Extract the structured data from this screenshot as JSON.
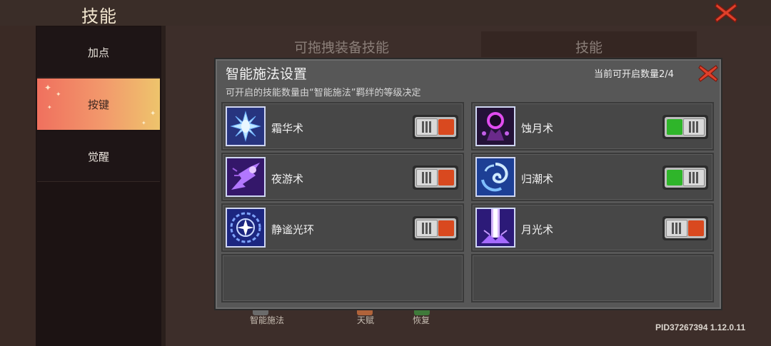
{
  "header": {
    "title": "技能"
  },
  "sidebar": {
    "items": [
      {
        "label": "加点"
      },
      {
        "label": "按键"
      },
      {
        "label": "觉醒"
      }
    ]
  },
  "background": {
    "left_heading": "可拖拽装备技能",
    "right_heading": "技能",
    "bottom_labels": [
      "智能施法",
      "天赋",
      "恢复"
    ],
    "version": "PID37267394 1.12.0.11"
  },
  "modal": {
    "title": "智能施法设置",
    "subtitle": "可开启的技能数量由“智能施法”羁绊的等级决定",
    "count_label": "当前可开启数量2/4",
    "skills": [
      {
        "name": "霜华术",
        "enabled": false,
        "icon": "frost-flower-icon"
      },
      {
        "name": "蚀月术",
        "enabled": true,
        "icon": "eclipse-icon"
      },
      {
        "name": "夜游术",
        "enabled": false,
        "icon": "night-walk-icon"
      },
      {
        "name": "归潮术",
        "enabled": true,
        "icon": "tide-vortex-icon"
      },
      {
        "name": "静谧光环",
        "enabled": false,
        "icon": "serene-aura-icon"
      },
      {
        "name": "月光术",
        "enabled": false,
        "icon": "moonlight-beam-icon"
      }
    ]
  },
  "colors": {
    "toggle_on": "#2fb52a",
    "toggle_off": "#d9491f",
    "active_tab_gradient_start": "#f0705e",
    "active_tab_gradient_end": "#eec46c",
    "close_red": "#e0402a"
  }
}
